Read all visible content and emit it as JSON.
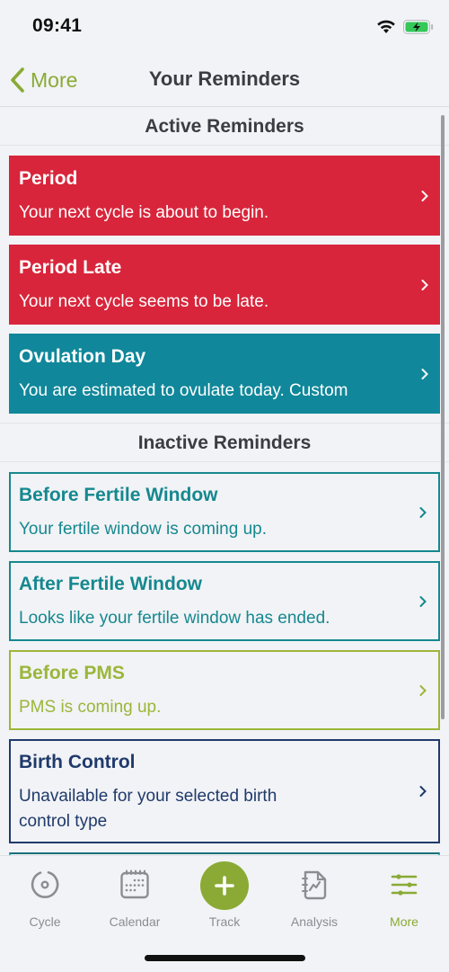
{
  "status_bar": {
    "time": "09:41",
    "icons": [
      "wifi-icon",
      "battery-charging-icon"
    ]
  },
  "nav": {
    "back_label": "More",
    "back_icon": "chevron-left-icon",
    "title": "Your Reminders"
  },
  "colors": {
    "accent": "#8aaa35",
    "period_red": "#d8253b",
    "ovulation_teal": "#10879a",
    "fertile_teal": "#15888f",
    "pms_green": "#9bb63a",
    "birth_control_navy": "#1f3a6b",
    "next_card_cyan": "#2bb5c2"
  },
  "sections": {
    "active": {
      "header": "Active Reminders",
      "items": [
        {
          "title": "Period",
          "description": "Your next cycle is about to begin."
        },
        {
          "title": "Period Late",
          "description": "Your next cycle seems to be late."
        },
        {
          "title": "Ovulation Day",
          "description": "You are estimated to ovulate today. Custom"
        }
      ]
    },
    "inactive": {
      "header": "Inactive Reminders",
      "items": [
        {
          "title": "Before Fertile Window",
          "description": "Your fertile window is coming up."
        },
        {
          "title": "After Fertile Window",
          "description": "Looks like your fertile window has ended."
        },
        {
          "title": "Before PMS",
          "description": "PMS is coming up."
        },
        {
          "title": "Birth Control",
          "description": "Unavailable for your selected birth control type"
        }
      ]
    }
  },
  "tab_bar": {
    "tabs": [
      {
        "label": "Cycle",
        "icon": "cycle-icon"
      },
      {
        "label": "Calendar",
        "icon": "calendar-icon"
      },
      {
        "label": "Track",
        "icon": "plus-icon"
      },
      {
        "label": "Analysis",
        "icon": "analysis-icon"
      },
      {
        "label": "More",
        "icon": "sliders-icon",
        "active": true
      }
    ]
  }
}
